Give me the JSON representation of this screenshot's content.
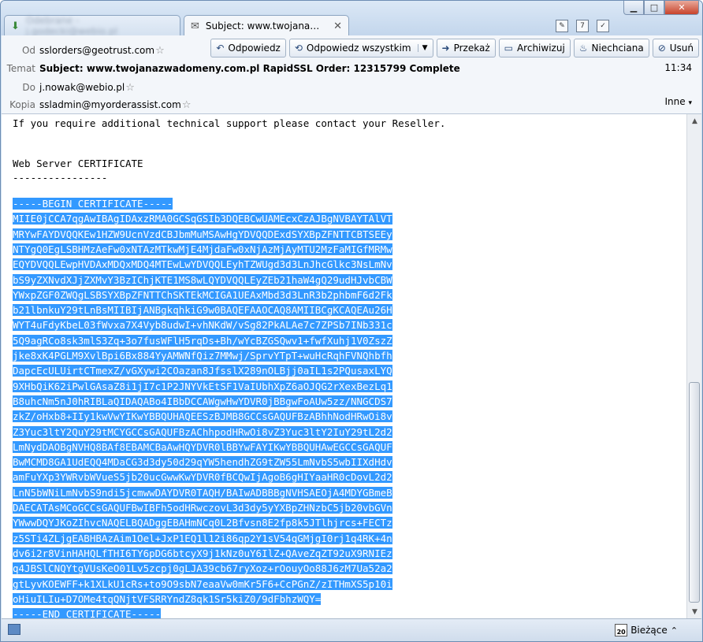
{
  "tabs": [
    {
      "label": "Odebrane - j.godecki@webio.pl",
      "active": false
    },
    {
      "label": "Subject: www.twojanazwa...",
      "active": true
    }
  ],
  "header": {
    "from_label": "Od",
    "from": "sslorders@geotrust.com",
    "subject_label": "Temat",
    "subject": "Subject: www.twojanazwadomeny.com.pl RapidSSL Order: 12315799 Complete",
    "to_label": "Do",
    "to": "j.nowak@webio.pl",
    "cc_label": "Kopia",
    "cc": "ssladmin@myorderassist.com",
    "time": "11:34",
    "more": "Inne"
  },
  "actions": {
    "reply": "Odpowiedz",
    "reply_all": "Odpowiedz wszystkim",
    "forward": "Przekaż",
    "archive": "Archiwizuj",
    "junk": "Niechciana",
    "delete": "Usuń"
  },
  "body": {
    "intro": "If you require additional technical support please contact your Reseller.",
    "cert_heading": "Web Server CERTIFICATE",
    "underline": "----------------",
    "cert_lines": [
      "-----BEGIN CERTIFICATE-----",
      "MIIE0jCCA7qgAwIBAgIDAxzRMA0GCSqGSIb3DQEBCwUAMEcxCzAJBgNVBAYTAlVT",
      "MRYwFAYDVQQKEw1HZW9UcnVzdCBJbmMuMSAwHgYDVQQDExdSYXBpZFNTTCBTSEEy",
      "NTYgQ0EgLSBHMzAeFw0xNTAzMTkwMjE4MjdaFw0xNjAzMjAyMTU2MzFaMIGfMRMw",
      "EQYDVQQLEwpHVDAxMDQxMDQ4MTEwLwYDVQQLEyhTZWUgd3d3LnJhcGlkc3NsLmNv",
      "bS9yZXNvdXJjZXMvY3BzIChjKTE1MS8wLQYDVQQLEyZEb21haW4gQ29udHJvbCBW",
      "YWxpZGF0ZWQgLSBSYXBpZFNTTChSKTEkMCIGA1UEAxMbd3d3LnR3b2phbmF6d2Fk",
      "b21lbnkuY29tLnBsMIIBIjANBgkqhkiG9w0BAQEFAAOCAQ8AMIIBCgKCAQEAu26H",
      "WYT4uFdyKbeL03fWvxa7X4Vyb8udwI+vhNKdW/vSg82PkALAe7c7ZPSb7INb331c",
      "5Q9agRCo8sk3mlS3Zq+3o7fusWFlH5rqDs+Bh/wYcBZGSQwv1+fwfXuhj1V0ZszZ",
      "jke8xK4PGLM9XvlBpi6Bx884YyAMWNfQiz7MMwj/SprvYTpT+wuHcRqhFVNQhbfh",
      "DapcEcULUirtCTmexZ/vGXywi2COazan8JfsslX289nOLBjj0aIL1s2PQusaxLYQ",
      "9XHbQiK62iPwlGAsaZ8i1jI7c1P2JNYVkEtSF1VaIUbhXpZ6aOJQG2rXexBezLq1",
      "B8uhcNm5nJ0hRIBLaQIDAQABo4IBbDCCAWgwHwYDVR0jBBgwFoAUw5zz/NNGCDS7",
      "zkZ/oHxb8+IIy1kwVwYIKwYBBQUHAQEESzBJMB8GCCsGAQUFBzABhhNodHRwOi8v",
      "Z3Yuc3ltY2QuY29tMCYGCCsGAQUFBzAChhpodHRwOi8vZ3Yuc3ltY2IuY29tL2d2",
      "LmNydDAOBgNVHQ8BAf8EBAMCBaAwHQYDVR0lBBYwFAYIKwYBBQUHAwEGCCsGAQUF",
      "BwMCMD8GA1UdEQQ4MDaCG3d3dy50d29qYW5hendhZG9tZW55LmNvbS5wbIIXdHdv",
      "amFuYXp3YWRvbWVueS5jb20ucGwwKwYDVR0fBCQwIjAgoB6gHIYaaHR0cDovL2d2",
      "LnN5bWNiLmNvbS9ndi5jcmwwDAYDVR0TAQH/BAIwADBBBgNVHSAEOjA4MDYGBmeB",
      "DAECATAsMCoGCCsGAQUFBwIBFh5odHRwczovL3d3dy5yYXBpZHNzbC5jb20vbGVn",
      "YWwwDQYJKoZIhvcNAQELBQADggEBAHmNCq0L2Bfvsn8E2fp8k5JTlhjrcs+FECTz",
      "z5STi4ZLjgEABHBAzAim1Oel+JxP1EQ1l12i86qp2Y1sV54qGMjgI0rj1q4RK+4n",
      "dv6i2r8VinHAHQLfTHI6TY6pDG6btcyX9j1kNz0uY6IlZ+QAveZqZT92uX9RNIEz",
      "q4JBSlCNQYtgVUsKeO01Lv5zcpj0gLJA39cb67ryXoz+rOouyOo88J6zM7Ua52a2",
      "gtLyvKOEWFF+k1XLkU1cRs+to9O9sbN7eaaVw0mKr5F6+CcPGnZ/zITHmXS5p10i",
      "oHiuILIu+D7OMe4tqQNjtVFSRRYndZ8qk1Sr5kiZ0/9dFbhzWQY=",
      "-----END CERTIFICATE-----"
    ]
  },
  "status": {
    "calendar_day": "20",
    "today": "Bieżące"
  }
}
